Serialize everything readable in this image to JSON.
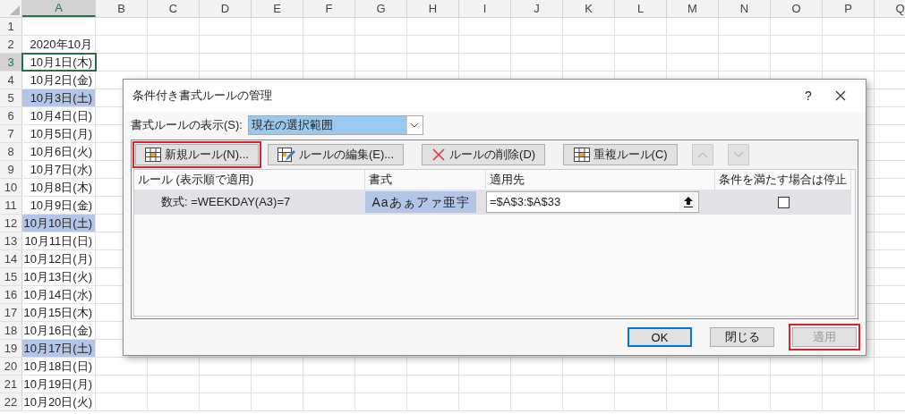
{
  "sheet": {
    "columns": [
      {
        "label": "A",
        "selected": true
      },
      {
        "label": "B",
        "selected": false
      },
      {
        "label": "C",
        "selected": false
      },
      {
        "label": "D",
        "selected": false
      },
      {
        "label": "E",
        "selected": false
      },
      {
        "label": "F",
        "selected": false
      },
      {
        "label": "G",
        "selected": false
      },
      {
        "label": "H",
        "selected": false
      },
      {
        "label": "I",
        "selected": false
      },
      {
        "label": "J",
        "selected": false
      },
      {
        "label": "K",
        "selected": false
      },
      {
        "label": "L",
        "selected": false
      },
      {
        "label": "M",
        "selected": false
      },
      {
        "label": "N",
        "selected": false
      },
      {
        "label": "O",
        "selected": false
      },
      {
        "label": "P",
        "selected": false
      },
      {
        "label": "Q",
        "selected": false
      }
    ],
    "rows": [
      {
        "number": "1",
        "selected": false,
        "highlighted": false
      },
      {
        "number": "2",
        "cell_a": "2020年10月",
        "selected": false,
        "highlighted": false
      },
      {
        "number": "3",
        "cell_a": "10月1日(木)",
        "selected": true,
        "highlighted": false
      },
      {
        "number": "4",
        "cell_a": "10月2日(金)",
        "selected": false,
        "highlighted": false
      },
      {
        "number": "5",
        "cell_a": "10月3日(土)",
        "selected": false,
        "highlighted": true
      },
      {
        "number": "6",
        "cell_a": "10月4日(日)",
        "selected": false,
        "highlighted": false
      },
      {
        "number": "7",
        "cell_a": "10月5日(月)",
        "selected": false,
        "highlighted": false
      },
      {
        "number": "8",
        "cell_a": "10月6日(火)",
        "selected": false,
        "highlighted": false
      },
      {
        "number": "9",
        "cell_a": "10月7日(水)",
        "selected": false,
        "highlighted": false
      },
      {
        "number": "10",
        "cell_a": "10月8日(木)",
        "selected": false,
        "highlighted": false
      },
      {
        "number": "11",
        "cell_a": "10月9日(金)",
        "selected": false,
        "highlighted": false
      },
      {
        "number": "12",
        "cell_a": "10月10日(土)",
        "selected": false,
        "highlighted": true
      },
      {
        "number": "13",
        "cell_a": "10月11日(日)",
        "selected": false,
        "highlighted": false
      },
      {
        "number": "14",
        "cell_a": "10月12日(月)",
        "selected": false,
        "highlighted": false
      },
      {
        "number": "15",
        "cell_a": "10月13日(火)",
        "selected": false,
        "highlighted": false
      },
      {
        "number": "16",
        "cell_a": "10月14日(水)",
        "selected": false,
        "highlighted": false
      },
      {
        "number": "17",
        "cell_a": "10月15日(木)",
        "selected": false,
        "highlighted": false
      },
      {
        "number": "18",
        "cell_a": "10月16日(金)",
        "selected": false,
        "highlighted": false
      },
      {
        "number": "19",
        "cell_a": "10月17日(土)",
        "selected": false,
        "highlighted": true
      },
      {
        "number": "20",
        "cell_a": "10月18日(日)",
        "selected": false,
        "highlighted": false
      },
      {
        "number": "21",
        "cell_a": "10月19日(月)",
        "selected": false,
        "highlighted": false
      },
      {
        "number": "22",
        "cell_a": "10月20日(火)",
        "selected": false,
        "highlighted": false
      }
    ]
  },
  "dialog": {
    "title": "条件付き書式ルールの管理",
    "help": "?",
    "show_rules_label": "書式ルールの表示(S):",
    "show_rules_value": "現在の選択範囲",
    "toolbar": [
      {
        "kind": "new",
        "label": "新規ルール(N)...",
        "highlighted": true,
        "disabled": false
      },
      {
        "kind": "edit",
        "label": "ルールの編集(E)...",
        "highlighted": false,
        "disabled": false
      },
      {
        "kind": "delete",
        "label": "ルールの削除(D)",
        "highlighted": false,
        "disabled": false
      },
      {
        "kind": "duplicate",
        "label": "重複ルール(C)",
        "highlighted": false,
        "disabled": false
      },
      {
        "kind": "up",
        "highlighted": false,
        "disabled": true
      },
      {
        "kind": "down",
        "highlighted": false,
        "disabled": true
      }
    ],
    "table": {
      "columns": [
        "ルール (表示順で適用)",
        "書式",
        "適用先",
        "条件を満たす場合は停止"
      ],
      "rows": [
        {
          "rule": "数式: =WEEKDAY(A3)=7",
          "format_preview": "Aaあぁアァ亜宇",
          "applies_to": "=$A$3:$A$33",
          "stop_if_true": false,
          "selected": true
        }
      ]
    },
    "buttons": [
      {
        "label": "OK",
        "default": true,
        "disabled": false,
        "highlighted": false
      },
      {
        "label": "閉じる",
        "default": false,
        "disabled": false,
        "highlighted": false
      },
      {
        "label": "適用",
        "default": false,
        "disabled": true,
        "highlighted": true
      }
    ]
  }
}
